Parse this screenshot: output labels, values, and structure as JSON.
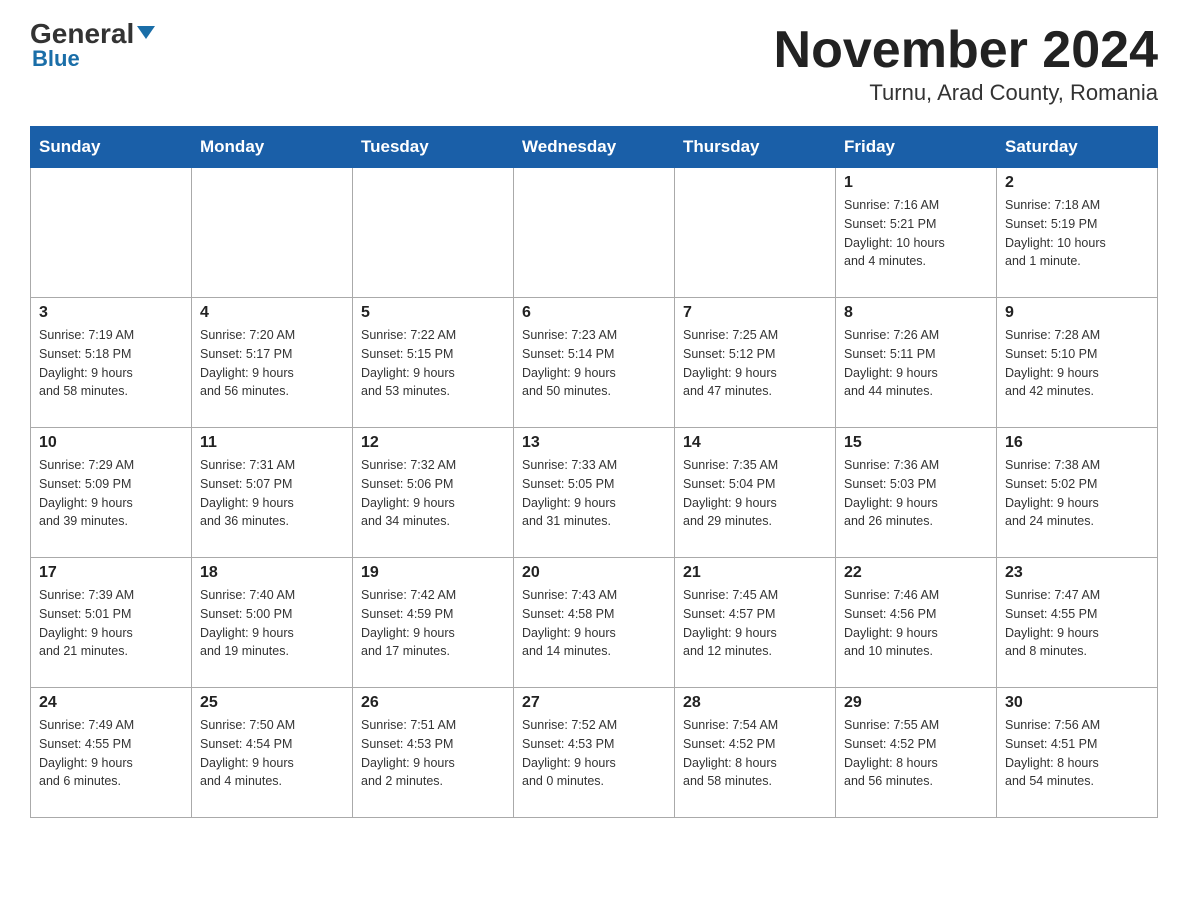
{
  "header": {
    "logo_main": "General",
    "logo_triangle": "▶",
    "logo_sub": "Blue",
    "title": "November 2024",
    "subtitle": "Turnu, Arad County, Romania"
  },
  "days_of_week": [
    "Sunday",
    "Monday",
    "Tuesday",
    "Wednesday",
    "Thursday",
    "Friday",
    "Saturday"
  ],
  "weeks": [
    [
      {
        "day": "",
        "info": ""
      },
      {
        "day": "",
        "info": ""
      },
      {
        "day": "",
        "info": ""
      },
      {
        "day": "",
        "info": ""
      },
      {
        "day": "",
        "info": ""
      },
      {
        "day": "1",
        "info": "Sunrise: 7:16 AM\nSunset: 5:21 PM\nDaylight: 10 hours\nand 4 minutes."
      },
      {
        "day": "2",
        "info": "Sunrise: 7:18 AM\nSunset: 5:19 PM\nDaylight: 10 hours\nand 1 minute."
      }
    ],
    [
      {
        "day": "3",
        "info": "Sunrise: 7:19 AM\nSunset: 5:18 PM\nDaylight: 9 hours\nand 58 minutes."
      },
      {
        "day": "4",
        "info": "Sunrise: 7:20 AM\nSunset: 5:17 PM\nDaylight: 9 hours\nand 56 minutes."
      },
      {
        "day": "5",
        "info": "Sunrise: 7:22 AM\nSunset: 5:15 PM\nDaylight: 9 hours\nand 53 minutes."
      },
      {
        "day": "6",
        "info": "Sunrise: 7:23 AM\nSunset: 5:14 PM\nDaylight: 9 hours\nand 50 minutes."
      },
      {
        "day": "7",
        "info": "Sunrise: 7:25 AM\nSunset: 5:12 PM\nDaylight: 9 hours\nand 47 minutes."
      },
      {
        "day": "8",
        "info": "Sunrise: 7:26 AM\nSunset: 5:11 PM\nDaylight: 9 hours\nand 44 minutes."
      },
      {
        "day": "9",
        "info": "Sunrise: 7:28 AM\nSunset: 5:10 PM\nDaylight: 9 hours\nand 42 minutes."
      }
    ],
    [
      {
        "day": "10",
        "info": "Sunrise: 7:29 AM\nSunset: 5:09 PM\nDaylight: 9 hours\nand 39 minutes."
      },
      {
        "day": "11",
        "info": "Sunrise: 7:31 AM\nSunset: 5:07 PM\nDaylight: 9 hours\nand 36 minutes."
      },
      {
        "day": "12",
        "info": "Sunrise: 7:32 AM\nSunset: 5:06 PM\nDaylight: 9 hours\nand 34 minutes."
      },
      {
        "day": "13",
        "info": "Sunrise: 7:33 AM\nSunset: 5:05 PM\nDaylight: 9 hours\nand 31 minutes."
      },
      {
        "day": "14",
        "info": "Sunrise: 7:35 AM\nSunset: 5:04 PM\nDaylight: 9 hours\nand 29 minutes."
      },
      {
        "day": "15",
        "info": "Sunrise: 7:36 AM\nSunset: 5:03 PM\nDaylight: 9 hours\nand 26 minutes."
      },
      {
        "day": "16",
        "info": "Sunrise: 7:38 AM\nSunset: 5:02 PM\nDaylight: 9 hours\nand 24 minutes."
      }
    ],
    [
      {
        "day": "17",
        "info": "Sunrise: 7:39 AM\nSunset: 5:01 PM\nDaylight: 9 hours\nand 21 minutes."
      },
      {
        "day": "18",
        "info": "Sunrise: 7:40 AM\nSunset: 5:00 PM\nDaylight: 9 hours\nand 19 minutes."
      },
      {
        "day": "19",
        "info": "Sunrise: 7:42 AM\nSunset: 4:59 PM\nDaylight: 9 hours\nand 17 minutes."
      },
      {
        "day": "20",
        "info": "Sunrise: 7:43 AM\nSunset: 4:58 PM\nDaylight: 9 hours\nand 14 minutes."
      },
      {
        "day": "21",
        "info": "Sunrise: 7:45 AM\nSunset: 4:57 PM\nDaylight: 9 hours\nand 12 minutes."
      },
      {
        "day": "22",
        "info": "Sunrise: 7:46 AM\nSunset: 4:56 PM\nDaylight: 9 hours\nand 10 minutes."
      },
      {
        "day": "23",
        "info": "Sunrise: 7:47 AM\nSunset: 4:55 PM\nDaylight: 9 hours\nand 8 minutes."
      }
    ],
    [
      {
        "day": "24",
        "info": "Sunrise: 7:49 AM\nSunset: 4:55 PM\nDaylight: 9 hours\nand 6 minutes."
      },
      {
        "day": "25",
        "info": "Sunrise: 7:50 AM\nSunset: 4:54 PM\nDaylight: 9 hours\nand 4 minutes."
      },
      {
        "day": "26",
        "info": "Sunrise: 7:51 AM\nSunset: 4:53 PM\nDaylight: 9 hours\nand 2 minutes."
      },
      {
        "day": "27",
        "info": "Sunrise: 7:52 AM\nSunset: 4:53 PM\nDaylight: 9 hours\nand 0 minutes."
      },
      {
        "day": "28",
        "info": "Sunrise: 7:54 AM\nSunset: 4:52 PM\nDaylight: 8 hours\nand 58 minutes."
      },
      {
        "day": "29",
        "info": "Sunrise: 7:55 AM\nSunset: 4:52 PM\nDaylight: 8 hours\nand 56 minutes."
      },
      {
        "day": "30",
        "info": "Sunrise: 7:56 AM\nSunset: 4:51 PM\nDaylight: 8 hours\nand 54 minutes."
      }
    ]
  ]
}
